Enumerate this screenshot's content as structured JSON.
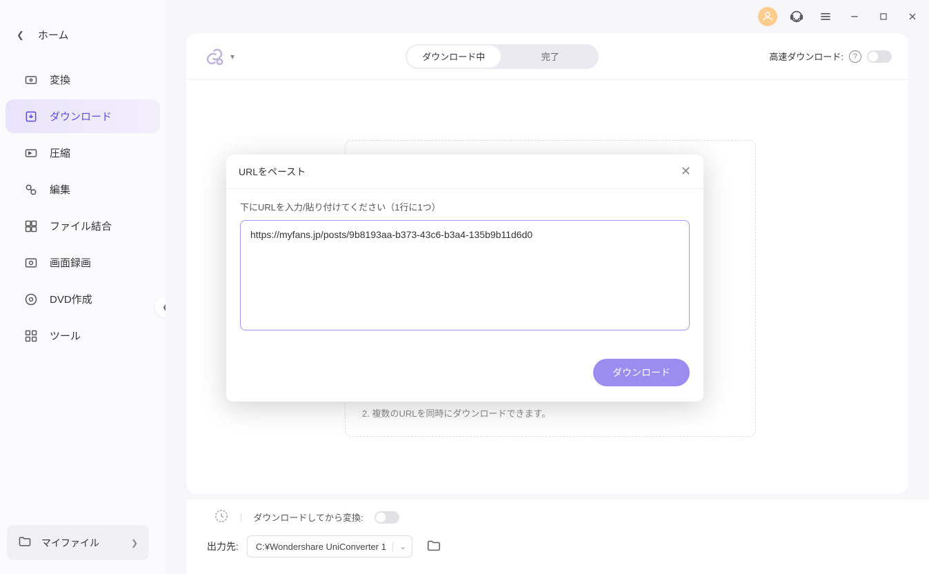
{
  "sidebar": {
    "home": "ホーム",
    "items": [
      {
        "label": "変換",
        "icon": "convert"
      },
      {
        "label": "ダウンロード",
        "icon": "download",
        "active": true
      },
      {
        "label": "圧縮",
        "icon": "compress"
      },
      {
        "label": "編集",
        "icon": "edit"
      },
      {
        "label": "ファイル結合",
        "icon": "merge"
      },
      {
        "label": "画面録画",
        "icon": "record"
      },
      {
        "label": "DVD作成",
        "icon": "dvd"
      },
      {
        "label": "ツール",
        "icon": "tools"
      }
    ],
    "myfile": "マイファイル"
  },
  "header": {
    "tabs": {
      "downloading": "ダウンロード中",
      "done": "完了"
    },
    "speed_label": "高速ダウンロード:"
  },
  "dropzone": {
    "tip2": "2. 複数のURLを同時にダウンロードできます。"
  },
  "footer": {
    "convert_after": "ダウンロードしてから変換:",
    "output_label": "出力先:",
    "output_path": "C:¥Wondershare UniConverter 1"
  },
  "modal": {
    "title": "URLをペースト",
    "desc": "下にURLを入力/貼り付けてください（1行に1つ）",
    "url_value": "https://myfans.jp/posts/9b8193aa-b373-43c6-b3a4-135b9b11d6d0",
    "download_btn": "ダウンロード"
  }
}
